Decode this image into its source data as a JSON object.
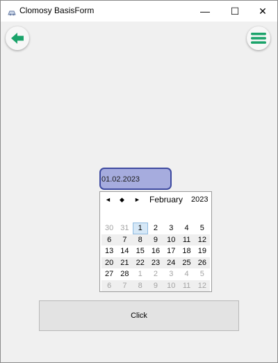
{
  "window": {
    "title": "Clomosy BasisForm",
    "minimize_glyph": "—",
    "maximize_glyph": "☐",
    "close_glyph": "✕"
  },
  "toolbar": {
    "back_icon": "arrow-left-icon",
    "menu_icon": "hamburger-menu-icon",
    "accent_color": "#1aa36a"
  },
  "date_field": {
    "value": "01.02.2023",
    "fill_color": "#a6acde",
    "border_color": "#3e4aa0"
  },
  "calendar": {
    "nav_prev": "◄",
    "nav_today": "◆",
    "nav_next": "►",
    "month": "February",
    "year": "2023",
    "selected_day": "1",
    "weeks": [
      [
        {
          "d": "30",
          "m": true
        },
        {
          "d": "31",
          "m": true
        },
        {
          "d": "1",
          "m": false,
          "s": true
        },
        {
          "d": "2",
          "m": false
        },
        {
          "d": "3",
          "m": false
        },
        {
          "d": "4",
          "m": false
        },
        {
          "d": "5",
          "m": false
        }
      ],
      [
        {
          "d": "6",
          "m": false
        },
        {
          "d": "7",
          "m": false
        },
        {
          "d": "8",
          "m": false
        },
        {
          "d": "9",
          "m": false
        },
        {
          "d": "10",
          "m": false
        },
        {
          "d": "11",
          "m": false
        },
        {
          "d": "12",
          "m": false
        }
      ],
      [
        {
          "d": "13",
          "m": false
        },
        {
          "d": "14",
          "m": false
        },
        {
          "d": "15",
          "m": false
        },
        {
          "d": "16",
          "m": false
        },
        {
          "d": "17",
          "m": false
        },
        {
          "d": "18",
          "m": false
        },
        {
          "d": "19",
          "m": false
        }
      ],
      [
        {
          "d": "20",
          "m": false
        },
        {
          "d": "21",
          "m": false
        },
        {
          "d": "22",
          "m": false
        },
        {
          "d": "23",
          "m": false
        },
        {
          "d": "24",
          "m": false
        },
        {
          "d": "25",
          "m": false
        },
        {
          "d": "26",
          "m": false
        }
      ],
      [
        {
          "d": "27",
          "m": false
        },
        {
          "d": "28",
          "m": false
        },
        {
          "d": "1",
          "m": true
        },
        {
          "d": "2",
          "m": true
        },
        {
          "d": "3",
          "m": true
        },
        {
          "d": "4",
          "m": true
        },
        {
          "d": "5",
          "m": true
        }
      ],
      [
        {
          "d": "6",
          "m": true
        },
        {
          "d": "7",
          "m": true
        },
        {
          "d": "8",
          "m": true
        },
        {
          "d": "9",
          "m": true
        },
        {
          "d": "10",
          "m": true
        },
        {
          "d": "11",
          "m": true
        },
        {
          "d": "12",
          "m": true
        }
      ]
    ]
  },
  "button": {
    "label": "Click"
  }
}
